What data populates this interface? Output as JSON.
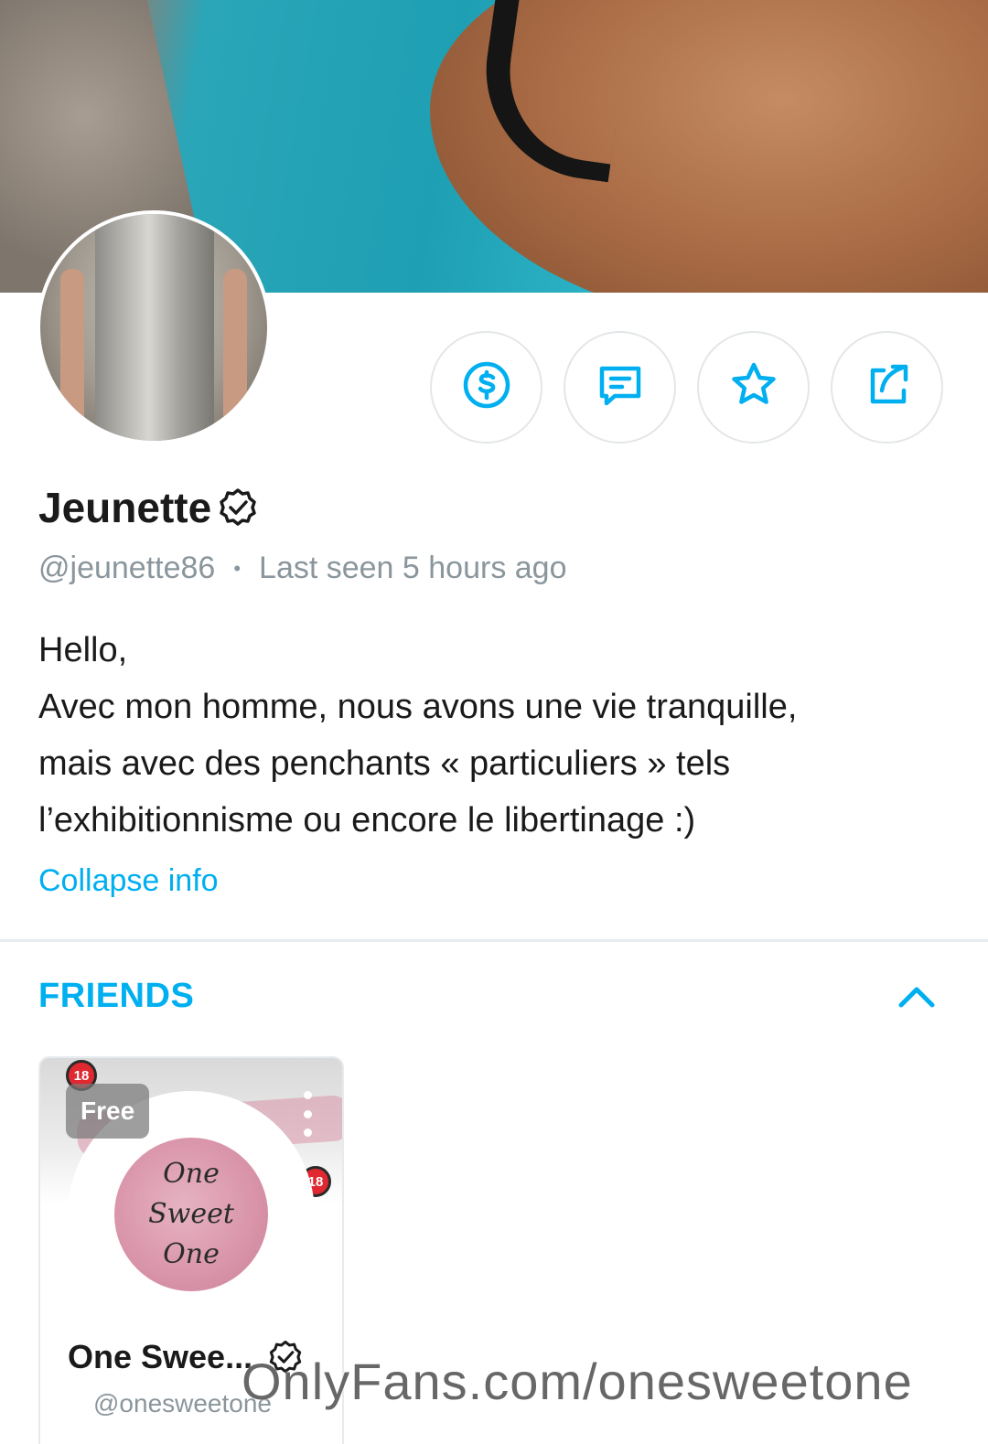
{
  "profile": {
    "name": "Jeunette",
    "handle": "@jeunette86",
    "separator": "•",
    "last_seen": "Last seen 5 hours ago",
    "bio_lines": [
      "Hello,",
      "Avec mon homme, nous avons une vie tranquille,",
      "mais avec des penchants «  particuliers » tels",
      "l’exhibitionnisme ou encore le libertinage :)"
    ],
    "collapse_label": "Collapse info"
  },
  "actions": [
    {
      "icon": "dollar-tip-icon"
    },
    {
      "icon": "message-icon"
    },
    {
      "icon": "star-favorite-icon"
    },
    {
      "icon": "share-icon"
    }
  ],
  "friends": {
    "title": "FRIENDS",
    "items": [
      {
        "name": "One Swee...",
        "handle": "@onesweetone",
        "price_badge": "Free",
        "age_badge": "18",
        "avatar_text": [
          "One",
          "Sweet",
          "One"
        ]
      }
    ]
  },
  "watermark": "OnlyFans.com/onesweetone",
  "colors": {
    "accent": "#00aff0",
    "muted_text": "#8a969c",
    "border": "#e6ebee"
  }
}
